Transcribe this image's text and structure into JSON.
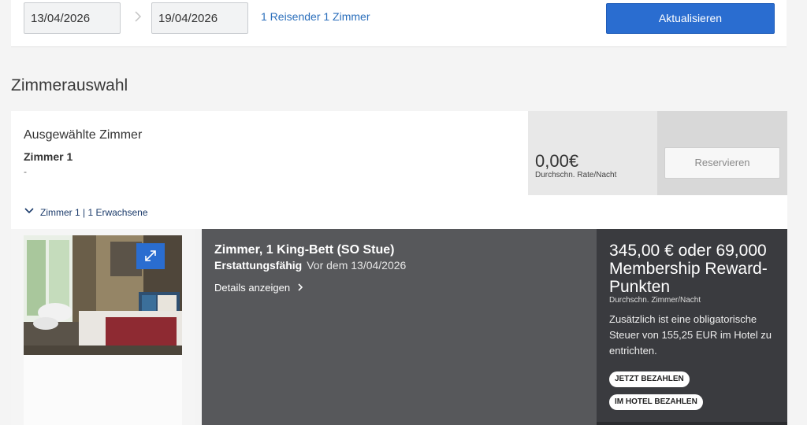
{
  "search": {
    "checkin": "13/04/2026",
    "checkout": "19/04/2026",
    "guests": "1 Reisender 1 Zimmer",
    "update_label": "Aktualisieren"
  },
  "section": {
    "title": "Zimmerauswahl"
  },
  "selected": {
    "title": "Ausgewählte Zimmer",
    "room_label": "Zimmer 1",
    "room_value": "-",
    "rate_value": "0,00€",
    "rate_label": "Durchschn. Rate/Nacht",
    "reserve_label": "Reservieren"
  },
  "expand": {
    "label": "Zimmer 1 | 1 Erwachsene"
  },
  "room": {
    "name": "Zimmer, 1 King-Bett (SO Stue)",
    "refund_label": "Erstattungsfähig",
    "refund_until": "Vor dem 13/04/2026",
    "details_label": "Details anzeigen",
    "price": "345,00 € oder 69,000 Membership Reward-Punkten",
    "price_sub": "Durchschn. Zimmer/Nacht",
    "tax_note": "Zusätzlich ist eine obligatorische Steuer von 155,25 EUR im Hotel zu entrichten.",
    "pay_now": "JETZT BEZAHLEN",
    "pay_hotel": "IM HOTEL BEZAHLEN"
  },
  "colors": {
    "accent_blue": "#2a6dd0",
    "link_blue": "#2a6ebb",
    "card_mid": "#57585b",
    "card_right": "#3a3b3f"
  }
}
